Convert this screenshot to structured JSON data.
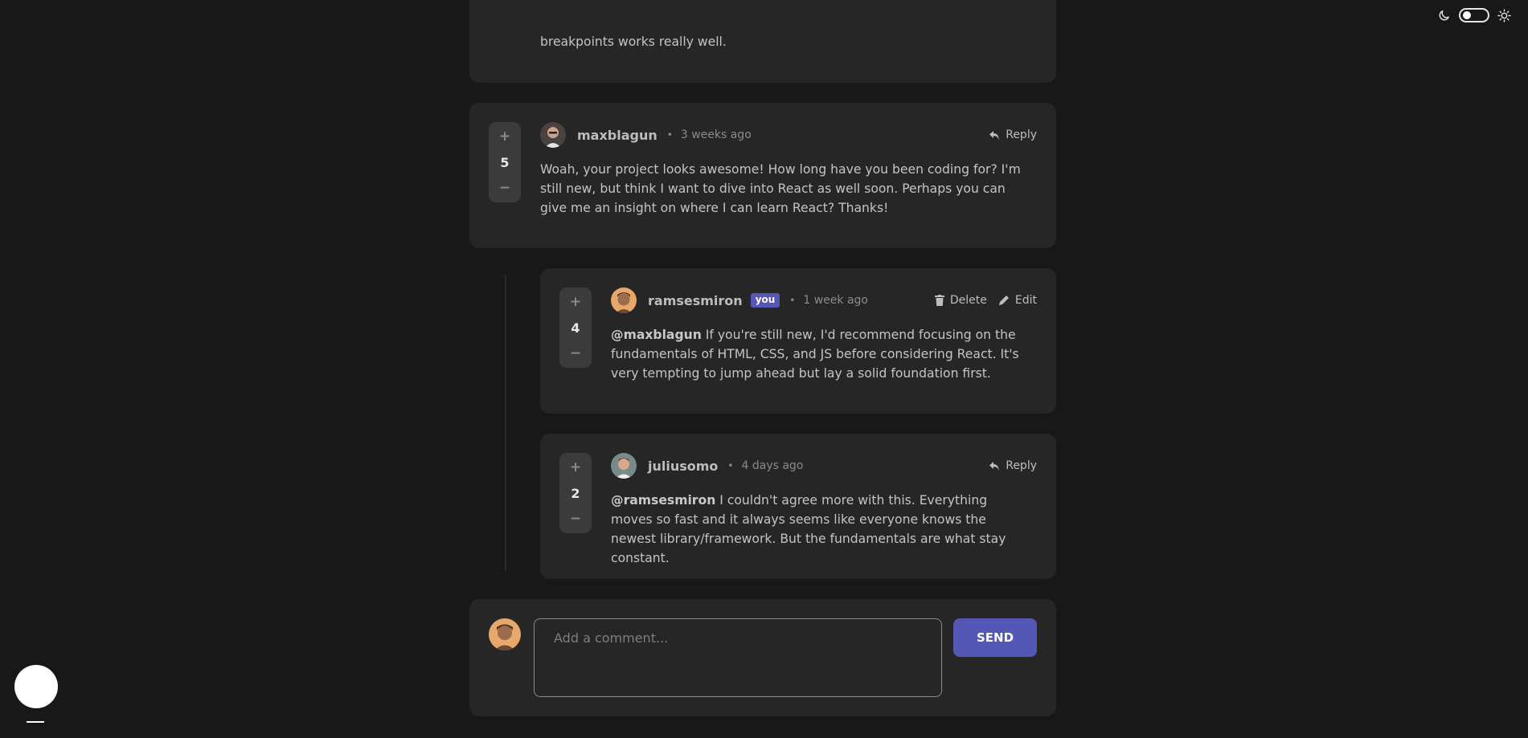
{
  "colors": {
    "accent": "#5457b6",
    "background": "#181818",
    "card": "#262626"
  },
  "partial_comment": {
    "text_tail": "breakpoints works really well."
  },
  "comments": [
    {
      "score": "5",
      "username": "maxblagun",
      "time": "3 weeks ago",
      "action": "Reply",
      "mention": "",
      "content": "Woah, your project looks awesome! How long have you been coding for? I'm still new, but think I want to dive into React as well soon. Perhaps you can give me an insight on where I can learn React? Thanks!"
    },
    {
      "score": "4",
      "username": "ramsesmiron",
      "badge": "you",
      "time": "1 week ago",
      "delete_label": "Delete",
      "edit_label": "Edit",
      "mention": "@maxblagun",
      "content": " If you're still new, I'd recommend focusing on the fundamentals of HTML, CSS, and JS before considering React. It's very tempting to jump ahead but lay a solid foundation first."
    },
    {
      "score": "2",
      "username": "juliusomo",
      "time": "4 days ago",
      "action": "Reply",
      "mention": "@ramsesmiron",
      "content": " I couldn't agree more with this. Everything moves so fast and it always seems like everyone knows the newest library/framework. But the fundamentals are what stay constant."
    }
  ],
  "vote": {
    "plus": "+",
    "minus": "−"
  },
  "composer": {
    "placeholder": "Add a comment...",
    "send_label": "SEND"
  },
  "icons": [
    "moon-icon",
    "theme-switch",
    "sun-icon",
    "reply-icon",
    "delete-icon",
    "edit-icon"
  ]
}
